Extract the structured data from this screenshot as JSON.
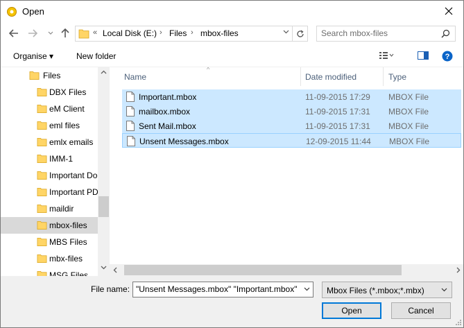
{
  "window": {
    "title": "Open"
  },
  "nav": {
    "address": {
      "overflow": "«",
      "segments": [
        "Local Disk (E:)",
        "Files",
        "mbox-files"
      ]
    },
    "search_placeholder": "Search mbox-files"
  },
  "commands": {
    "organise": "Organise ▾",
    "new_folder": "New folder"
  },
  "tree": {
    "root": "Files",
    "items": [
      "DBX Files",
      "eM Client",
      "eml files",
      "emlx emails",
      "IMM-1",
      "Important Do",
      "Important PD",
      "maildir",
      "mbox-files",
      "MBS Files",
      "mbx-files",
      "MSG Files"
    ],
    "selected": "mbox-files"
  },
  "columns": {
    "name": "Name",
    "date": "Date modified",
    "type": "Type"
  },
  "files": [
    {
      "name": "Important.mbox",
      "date": "11-09-2015 17:29",
      "type": "MBOX File"
    },
    {
      "name": "mailbox.mbox",
      "date": "11-09-2015 17:31",
      "type": "MBOX File"
    },
    {
      "name": "Sent Mail.mbox",
      "date": "11-09-2015 17:31",
      "type": "MBOX File"
    },
    {
      "name": "Unsent Messages.mbox",
      "date": "12-09-2015 11:44",
      "type": "MBOX File"
    }
  ],
  "footer": {
    "filename_label": "File name:",
    "filename_value": "\"Unsent Messages.mbox\" \"Important.mbox\"",
    "file_type": "Mbox Files (*.mbox;*.mbx)",
    "open_label": "Open",
    "cancel_label": "Cancel"
  },
  "colors": {
    "selection": "#cce8ff",
    "selection_border": "#99d1ff",
    "accent": "#0078d7",
    "folder": "#ffd566"
  }
}
